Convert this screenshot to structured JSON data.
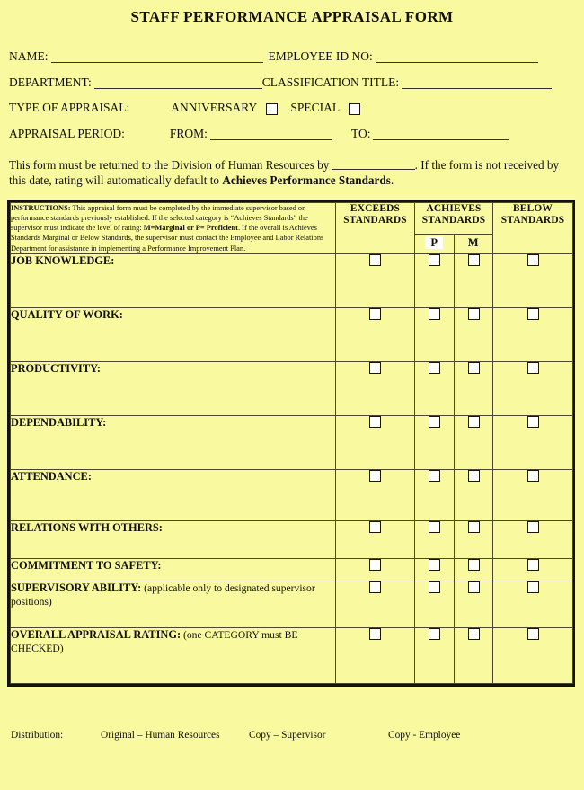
{
  "document": {
    "title": "STAFF PERFORMANCE APPRAISAL FORM",
    "background_color": "#f9f9a0",
    "ink_color": "#111008"
  },
  "fields": {
    "name_label": "NAME:",
    "employee_id_label": "EMPLOYEE ID NO:",
    "department_label": "DEPARTMENT:",
    "classification_title_label": "CLASSIFICATION TITLE:",
    "type_of_appraisal_label": "TYPE OF APPRAISAL:",
    "anniversary_label": "ANNIVERSARY",
    "special_label": "SPECIAL",
    "appraisal_period_label": "APPRAISAL PERIOD:",
    "from_label": "FROM:",
    "to_label": "TO:",
    "name_value": "",
    "employee_id_value": "",
    "department_value": "",
    "classification_title_value": "",
    "from_value": "",
    "to_value": "",
    "anniversary_checked": false,
    "special_checked": false
  },
  "notice": {
    "part1": "This form must be returned to the Division of Human Resources by ",
    "blank_value": "",
    "part2": ". If the form is not received by this date, rating will automatically default to ",
    "emphasis": "Achieves Performance Standards",
    "part3": "."
  },
  "table": {
    "instructions": {
      "lead": "INSTRUCTIONS:",
      "text1": " This appraisal form must be completed by the immediate supervisor based on performance standards previously established.  If the selected category is “Achieves Standards” the supervisor must indicate the level of rating: ",
      "bold1": "M=Marginal or P= Proficient",
      "text2": ".  If the overall is Achieves Standards Marginal or Below Standards, the supervisor must contact the Employee and Labor Relations Department for assistance in implementing a Performance Improvement Plan."
    },
    "columns": [
      {
        "line1": "EXCEEDS",
        "line2": "STANDARDS"
      },
      {
        "line1": "ACHIEVES",
        "line2": "STANDARDS"
      },
      {
        "line1": "BELOW",
        "line2": "STANDARDS"
      }
    ],
    "achieves_sub": [
      {
        "code": "P",
        "meaning": "Proficient",
        "highlighted": true
      },
      {
        "code": "M",
        "meaning": "Marginal",
        "highlighted": false
      }
    ],
    "rows": [
      {
        "label": "JOB KNOWLEDGE:",
        "note": "",
        "height": "tall"
      },
      {
        "label": "QUALITY OF WORK:",
        "note": "",
        "height": "tall"
      },
      {
        "label": "PRODUCTIVITY:",
        "note": "",
        "height": "tall"
      },
      {
        "label": "DEPENDABILITY:",
        "note": "",
        "height": "tall"
      },
      {
        "label": "ATTENDANCE:",
        "note": "",
        "height": "tall"
      },
      {
        "label": "RELATIONS WITH OTHERS:",
        "note": "",
        "height": "medium"
      },
      {
        "label": "COMMITMENT TO SAFETY:",
        "note": "",
        "height": "short"
      },
      {
        "label": "SUPERVISORY ABILITY:",
        "note": " (applicable only to designated supervisor positions)",
        "height": "medium"
      },
      {
        "label": "OVERALL APPRAISAL RATING:",
        "note": " (one CATEGORY must BE CHECKED)",
        "height": "tall"
      }
    ]
  },
  "footer": {
    "distribution_label": "Distribution:",
    "original": "Original – Human Resources",
    "copy_supervisor": "Copy – Supervisor",
    "copy_employee": "Copy - Employee"
  }
}
